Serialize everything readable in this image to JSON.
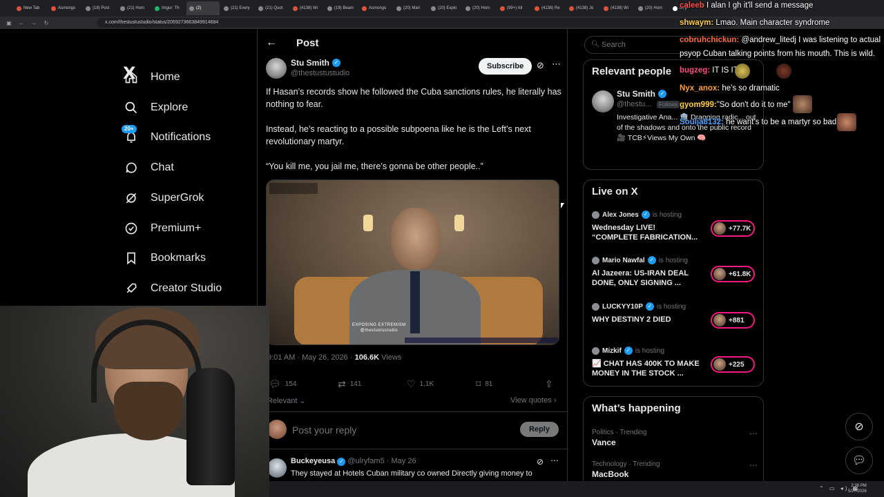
{
  "browser": {
    "tabs": [
      {
        "label": "New Tab",
        "color": "#e0533a"
      },
      {
        "label": "Asmongo",
        "color": "#e0533a"
      },
      {
        "label": "(18) Post",
        "color": "#888888"
      },
      {
        "label": "(21) Hom",
        "color": "#888888"
      },
      {
        "label": "Imgur: Th",
        "color": "#1bb76e"
      },
      {
        "label": "(2)",
        "color": "#888888"
      },
      {
        "label": "(21) Every",
        "color": "#888888"
      },
      {
        "label": "(21) Quot",
        "color": "#888888"
      },
      {
        "label": "(4138) Wi",
        "color": "#e0533a"
      },
      {
        "label": "(19) Beam",
        "color": "#888888"
      },
      {
        "label": "Asmongo",
        "color": "#e0533a"
      },
      {
        "label": "(20) Mari",
        "color": "#888888"
      },
      {
        "label": "(20) Explo",
        "color": "#888888"
      },
      {
        "label": "(20) Hom",
        "color": "#888888"
      },
      {
        "label": "(99+) All",
        "color": "#e0533a"
      },
      {
        "label": "(4138) Re",
        "color": "#e0533a"
      },
      {
        "label": "(4138) Jo",
        "color": "#e0533a"
      },
      {
        "label": "(4138) Wi",
        "color": "#e0533a"
      },
      {
        "label": "(20) Hom",
        "color": "#888888"
      },
      {
        "label": "oil p",
        "color": "#ffffff"
      }
    ],
    "active_tab_index": 5,
    "url": "x.com/thestustustudio/status/2059273663849914684"
  },
  "leftnav": {
    "logo": "X",
    "items": [
      {
        "label": "Home",
        "icon": "home-icon"
      },
      {
        "label": "Explore",
        "icon": "search-icon"
      },
      {
        "label": "Notifications",
        "icon": "bell-icon",
        "badge": "20+"
      },
      {
        "label": "Chat",
        "icon": "chat-icon"
      },
      {
        "label": "SuperGrok",
        "icon": "grok-icon"
      },
      {
        "label": "Premium+",
        "icon": "premium-icon"
      },
      {
        "label": "Bookmarks",
        "icon": "bookmark-icon"
      },
      {
        "label": "Creator Studio",
        "icon": "rocket-icon"
      }
    ]
  },
  "post": {
    "header_title": "Post",
    "author_name": "Stu Smith",
    "author_handle": "@thestustustudio",
    "subscribe_label": "Subscribe",
    "paragraphs": [
      "If Hasan’s records show he followed the Cuba sanctions rules, he literally has nothing to fear.",
      "Instead, he’s reacting to a possible subpoena like he is the Left’s next revolutionary martyr.",
      "“You kill me, you jail me, there’s gonna be other people..”"
    ],
    "video_watermark": "EXPOSING EXTREMISM",
    "video_watermark_handle": "@thestustustudio",
    "timestamp": "9:01 AM · May 26, 2026 · ",
    "views_count": "106.6K",
    "views_label": " Views",
    "stats": {
      "replies": "154",
      "reposts": "141",
      "likes": "1.1K",
      "bookmarks": "81"
    },
    "sort_label": "Relevant",
    "view_quotes_label": "View quotes",
    "reply_placeholder": "Post your reply",
    "reply_button": "Reply"
  },
  "reply": {
    "name": "Buckeyeusa",
    "handle": "@ulryfam5",
    "date": "· May 26",
    "text": "They stayed at Hotels Cuban military co owned Directly giving money to"
  },
  "sidebar": {
    "search_placeholder": "Search",
    "relevant_title": "Relevant people",
    "person": {
      "name": "Stu Smith",
      "handle": "@thestu...",
      "follows_badge": "Follows",
      "bio": "Investigative Ana... 🏛️ Dragging radic... out of the shadows and onto the public record 🎥 TCB⚡Views My Own 🧠"
    },
    "live_title": "Live on X",
    "live": [
      {
        "host": "Alex Jones",
        "status": "is hosting",
        "title": "Wednesday LIVE! “COMPLETE FABRICATION...",
        "count": "+77.7K"
      },
      {
        "host": "Mario Nawfal",
        "status": "is hosting",
        "title": "Al Jazeera: US-IRAN DEAL DONE, ONLY SIGNING ...",
        "count": "+61.8K"
      },
      {
        "host": "LUCKYY10P",
        "status": "is hosting",
        "title": "WHY DESTINY 2 DIED",
        "count": "+881"
      },
      {
        "host": "Mizkif",
        "status": "is hosting",
        "title": "📈 CHAT HAS 400K TO MAKE MONEY IN THE STOCK ...",
        "count": "+225"
      }
    ],
    "happening_title": "What’s happening",
    "trends": [
      {
        "context": "Politics · Trending",
        "name": "Vance"
      },
      {
        "context": "Technology · Trending",
        "name": "MacBook"
      }
    ]
  },
  "chat": [
    {
      "user": "caleeb",
      "user_color": "#ff4e4e",
      "text": "I alan I gh it'll send a message"
    },
    {
      "user": "shwaym:",
      "user_color": "#ffcf3a",
      "text": "Lmao. Main character syndrome"
    },
    {
      "user": "cobruhchickun:",
      "user_color": "#ff6a3d",
      "text": "@andrew_litedj I was listening to actual"
    },
    {
      "user": "",
      "user_color": "#ffffff",
      "text": "psyop Cuban talking points from his mouth. This is wild."
    },
    {
      "user": "bugzeg:",
      "user_color": "#ff4e7a",
      "text": "IT IS  IT IS"
    },
    {
      "user": "Nyx_anox:",
      "user_color": "#ff9f3a",
      "text": "he's so dramatic"
    },
    {
      "user": "gyom999:",
      "user_color": "#ffcf3a",
      "text": "\"So don't do it to me\""
    },
    {
      "user": "Soulja8132:",
      "user_color": "#4ea1ff",
      "text": "he want's to be a martyr so bad"
    }
  ],
  "system": {
    "time": "2:38 PM",
    "date": "5/27/2026"
  },
  "colors": {
    "accent": "#1d9bf0",
    "live_ring": "#f91880",
    "border": "#2f3336",
    "muted": "#71767b"
  }
}
